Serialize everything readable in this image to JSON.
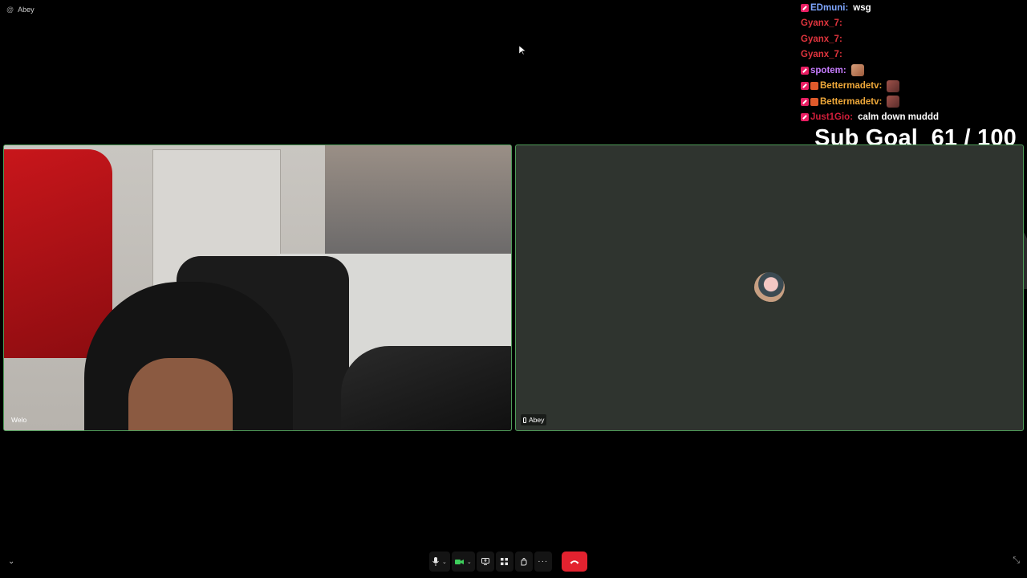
{
  "header": {
    "self_label": "Abey"
  },
  "chat": {
    "messages": [
      {
        "user": "EDmuni",
        "color": "#7ea6ff",
        "badges": [
          "mod"
        ],
        "text": "wsg",
        "emote": null
      },
      {
        "user": "Gyanx_7",
        "color": "#e0343d",
        "badges": [],
        "text": "",
        "emote": "face"
      },
      {
        "user": "Gyanx_7",
        "color": "#e0343d",
        "badges": [],
        "text": "",
        "emote": "face"
      },
      {
        "user": "Gyanx_7",
        "color": "#e0343d",
        "badges": [],
        "text": "",
        "emote": "face"
      },
      {
        "user": "spotem",
        "color": "#c77dff",
        "badges": [
          "mod"
        ],
        "text": "",
        "emote": "sq"
      },
      {
        "user": "Bettermadetv",
        "color": "#f0a93a",
        "badges": [
          "mod",
          "sub"
        ],
        "text": "",
        "emote": "dark"
      },
      {
        "user": "Bettermadetv",
        "color": "#f0a93a",
        "badges": [
          "mod",
          "sub"
        ],
        "text": "",
        "emote": "dark"
      },
      {
        "user": "Just1Gio",
        "color": "#d21e3a",
        "badges": [
          "mod"
        ],
        "text": "calm down muddd",
        "emote": null
      }
    ]
  },
  "sub_goal": {
    "label": "Sub Goal",
    "current": "61",
    "target": "100",
    "text": "Sub Goal  61 / 100"
  },
  "tiles": {
    "left": {
      "name": "Welo"
    },
    "right": {
      "name": "Abey"
    }
  },
  "controls": {
    "items": [
      "mic-icon",
      "chevron-down-icon",
      "camera-icon",
      "chevron-down-icon",
      "share-screen-icon",
      "apps-icon",
      "reactions-icon",
      "more-icon",
      "hang-up-icon"
    ],
    "camera_color": "#3ecf5c",
    "hangup_color": "#e3222f"
  }
}
